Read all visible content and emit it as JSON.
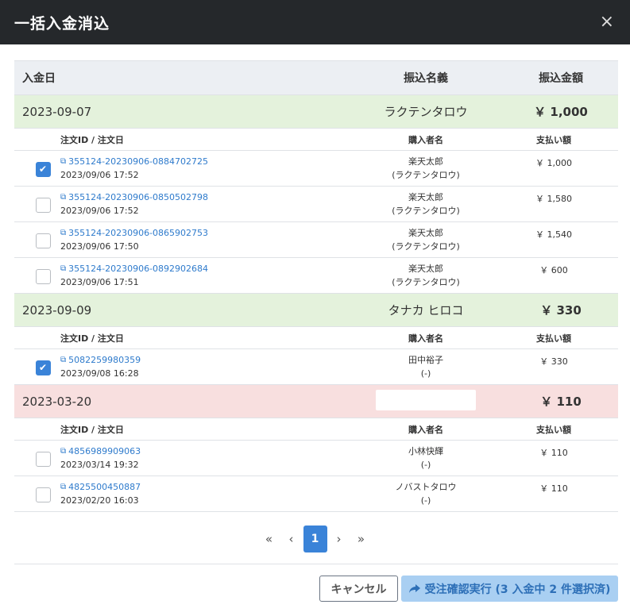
{
  "modal": {
    "title": "一括入金消込",
    "close_glyph": "×"
  },
  "table": {
    "headers": {
      "date": "入金日",
      "name": "振込名義",
      "amount": "振込金額"
    },
    "sub_headers": {
      "order": "注文ID / 注文日",
      "buyer": "購入者名",
      "payment": "支払い額"
    },
    "groups": [
      {
        "date": "2023-09-07",
        "name": "ラクテンタロウ",
        "amount": "￥ 1,000",
        "color": "#e4f2dc",
        "orders": [
          {
            "checked": true,
            "id": "355124-20230906-0884702725",
            "date": "2023/09/06 17:52",
            "buyer": "楽天太郎",
            "buyer_kana": "(ラクテンタロウ)",
            "payment": "￥ 1,000"
          },
          {
            "checked": false,
            "id": "355124-20230906-0850502798",
            "date": "2023/09/06 17:52",
            "buyer": "楽天太郎",
            "buyer_kana": "(ラクテンタロウ)",
            "payment": "￥ 1,580"
          },
          {
            "checked": false,
            "id": "355124-20230906-0865902753",
            "date": "2023/09/06 17:50",
            "buyer": "楽天太郎",
            "buyer_kana": "(ラクテンタロウ)",
            "payment": "￥ 1,540"
          },
          {
            "checked": false,
            "id": "355124-20230906-0892902684",
            "date": "2023/09/06 17:51",
            "buyer": "楽天太郎",
            "buyer_kana": "(ラクテンタロウ)",
            "payment": "￥ 600"
          }
        ]
      },
      {
        "date": "2023-09-09",
        "name": "タナカ ヒロコ",
        "amount": "￥ 330",
        "color": "#e4f2dc",
        "orders": [
          {
            "checked": true,
            "id": "5082259980359",
            "date": "2023/09/08 16:28",
            "buyer": "田中裕子",
            "buyer_kana": "(-)",
            "payment": "￥ 330"
          }
        ]
      },
      {
        "date": "2023-03-20",
        "name": "",
        "amount": "￥ 110",
        "color": "#f8dfdf",
        "orders": [
          {
            "checked": false,
            "id": "4856989909063",
            "date": "2023/03/14 19:32",
            "buyer": "小林快輝",
            "buyer_kana": "(-)",
            "payment": "￥ 110"
          },
          {
            "checked": false,
            "id": "4825500450887",
            "date": "2023/02/20 16:03",
            "buyer": "ノバストタロウ",
            "buyer_kana": "(-)",
            "payment": "￥ 110"
          }
        ]
      }
    ]
  },
  "pagination": {
    "first": "«",
    "prev": "‹",
    "current": "1",
    "next": "›",
    "last": "»"
  },
  "footer": {
    "cancel_label": "キャンセル",
    "execute_label": "受注確認実行 (3 入金中 2 件選択済)",
    "execute_icon": "share-icon"
  },
  "colors": {
    "header_bg": "#25282b",
    "accent": "#3a83d8",
    "link": "#2f7bcc",
    "matched_row": "#e4f2dc",
    "unmatched_row": "#f8dfdf",
    "execute_button_bg": "#a9cff2"
  }
}
